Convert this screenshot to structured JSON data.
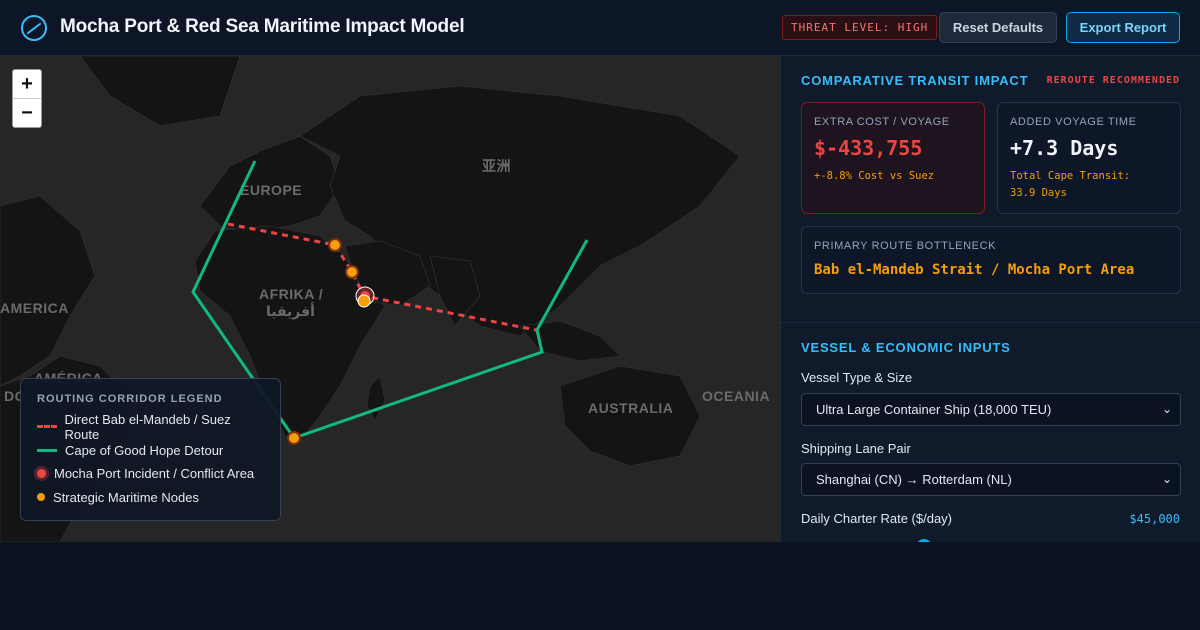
{
  "header": {
    "title": "Mocha Port & Red Sea Maritime Impact Model",
    "threat_level": "THREAT LEVEL: HIGH",
    "reset_label": "Reset Defaults",
    "export_label": "Export Report"
  },
  "map": {
    "zoom_in": "+",
    "zoom_out": "−",
    "labels": {
      "europe": "EUROPE",
      "asia": "亚洲",
      "africa_line1": "AFRIKA /",
      "africa_line2": "أفريقيا",
      "america": "AMERICA",
      "south_america": "AMÉRICA",
      "australia": "AUSTRALIA",
      "oceania": "OCEANIA",
      "do_partial": "DO"
    },
    "legend": {
      "title": "ROUTING CORRIDOR LEGEND",
      "items": [
        {
          "label": "Direct Bab el-Mandeb / Suez Route",
          "color": "#ef4444"
        },
        {
          "label": "Cape of Good Hope Detour",
          "color": "#10b981"
        },
        {
          "label": "Mocha Port Incident / Conflict Area",
          "color": "#ef4444"
        },
        {
          "label": "Strategic Maritime Nodes",
          "color": "#f59e0b"
        }
      ]
    }
  },
  "panel": {
    "impact_title": "COMPARATIVE TRANSIT IMPACT",
    "reroute_badge": "REROUTE RECOMMENDED",
    "cost_card": {
      "label": "EXTRA COST / VOYAGE",
      "value": "$-433,755",
      "sub": "+-8.8% Cost vs Suez"
    },
    "time_card": {
      "label": "ADDED VOYAGE TIME",
      "value": "+7.3 Days",
      "sub_line1": "Total Cape Transit:",
      "sub_line2": "33.9 Days"
    },
    "bottleneck": {
      "label": "PRIMARY ROUTE BOTTLENECK",
      "value": "Bab el-Mandeb Strait / Mocha Port Area"
    },
    "inputs_title": "VESSEL & ECONOMIC INPUTS",
    "vessel": {
      "label": "Vessel Type & Size",
      "value": "Ultra Large Container Ship (18,000 TEU)"
    },
    "lane": {
      "label": "Shipping Lane Pair",
      "value": "Shanghai (CN) → Rotterdam (NL)"
    },
    "charter": {
      "label": "Daily Charter Rate ($/day)",
      "value": "$45,000"
    }
  },
  "colors": {
    "accent": "#38bdf8",
    "danger": "#ef4444",
    "route_cape": "#10b981",
    "node": "#f59e0b"
  }
}
